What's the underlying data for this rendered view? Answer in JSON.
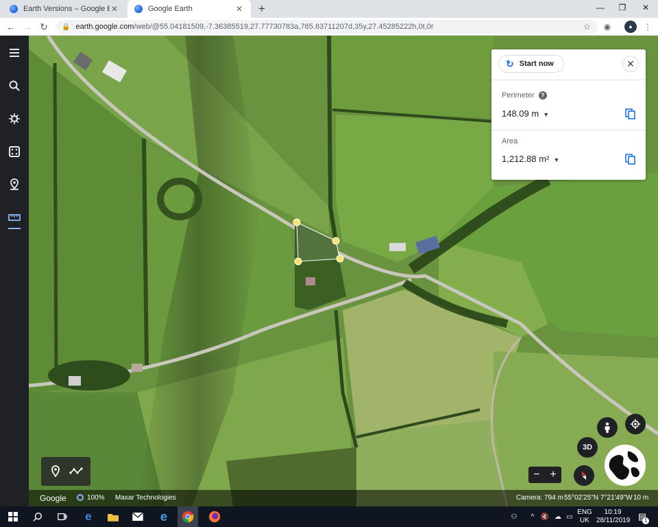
{
  "browser": {
    "tabs": [
      {
        "title": "Earth Versions – Google Earth",
        "active": false
      },
      {
        "title": "Google Earth",
        "active": true
      }
    ],
    "url_host": "earth.google.com",
    "url_path": "/web/@55.04181509,-7.36385519,27.77730783a,765.83711207d,35y,27.45285222h,0t,0r"
  },
  "sidebar": {
    "items": [
      {
        "icon": "menu-icon"
      },
      {
        "icon": "search-icon"
      },
      {
        "icon": "voyager-icon"
      },
      {
        "icon": "feeling-lucky-icon"
      },
      {
        "icon": "projects-icon"
      },
      {
        "icon": "ruler-icon",
        "active": true
      }
    ]
  },
  "measure": {
    "start_label": "Start now",
    "perimeter_label": "Perimeter",
    "perimeter_value": "148.09 m",
    "area_label": "Area",
    "area_value": "1,212.88 m²"
  },
  "controls": {
    "three_d_label": "3D",
    "zoom_out": "−",
    "zoom_in": "+"
  },
  "statusbar": {
    "brand": "Google",
    "load_percent": "100%",
    "attribution": "Maxar Technologies",
    "camera": "Camera: 794 m",
    "coordinates": "55°02'25\"N 7°21'49\"W",
    "scale": "10 m"
  },
  "taskbar": {
    "language_top": "ENG",
    "language_bottom": "UK",
    "time": "10:19",
    "date": "28/11/2019",
    "notifications": "1"
  },
  "colors": {
    "accent": "#1a73e8",
    "measure_point": "#f7e36b",
    "sidebar_bg": "#202124"
  }
}
